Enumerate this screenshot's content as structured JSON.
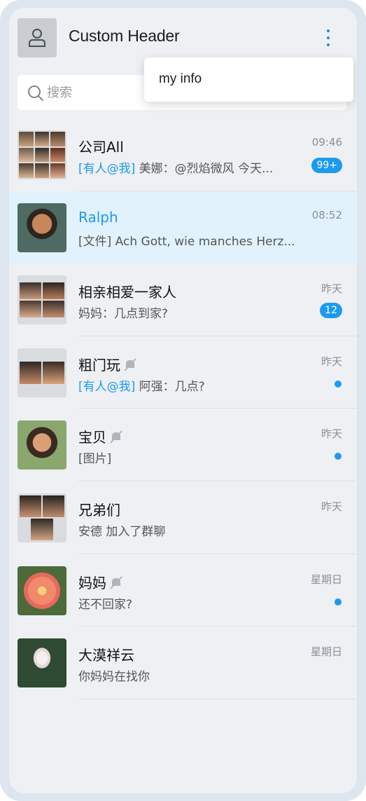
{
  "header": {
    "title": "Custom Header"
  },
  "search": {
    "placeholder": "搜索"
  },
  "menu": {
    "item": "my info"
  },
  "colors": {
    "accent": "#1b9bef",
    "active_row": "#e2f2fd"
  },
  "conversations": [
    {
      "name": "公司All",
      "time": "09:46",
      "mention": "[有人@我]",
      "preview": " 美娜：@烈焰微风 今天...",
      "badge": "99+",
      "avatar": "group-9"
    },
    {
      "name": "Ralph",
      "time": "08:52",
      "mention": "",
      "preview": "[文件] Ach Gott, wie manches Herz...",
      "badge": "",
      "avatar": "portrait-man"
    },
    {
      "name": "相亲相爱一家人",
      "time": "昨天",
      "mention": "",
      "preview": "妈妈：几点到家?",
      "badge": "12",
      "avatar": "group-4"
    },
    {
      "name": "粗门玩",
      "time": "昨天",
      "mention": "[有人@我]",
      "preview": " 阿强：几点?",
      "badge": "",
      "muted": true,
      "unread_dot": true,
      "avatar": "group-2"
    },
    {
      "name": "宝贝",
      "time": "昨天",
      "mention": "",
      "preview": "[图片]",
      "badge": "",
      "muted": true,
      "unread_dot": true,
      "avatar": "portrait-woman"
    },
    {
      "name": "兄弟们",
      "time": "昨天",
      "mention": "",
      "preview": "安德 加入了群聊",
      "badge": "",
      "avatar": "group-3"
    },
    {
      "name": "妈妈",
      "time": "星期日",
      "mention": "",
      "preview": "还不回家?",
      "badge": "",
      "muted": true,
      "unread_dot": true,
      "avatar": "flower-rose"
    },
    {
      "name": "大漠祥云",
      "time": "星期日",
      "mention": "",
      "preview": "你妈妈在找你",
      "badge": "",
      "avatar": "flower-lotus"
    }
  ]
}
